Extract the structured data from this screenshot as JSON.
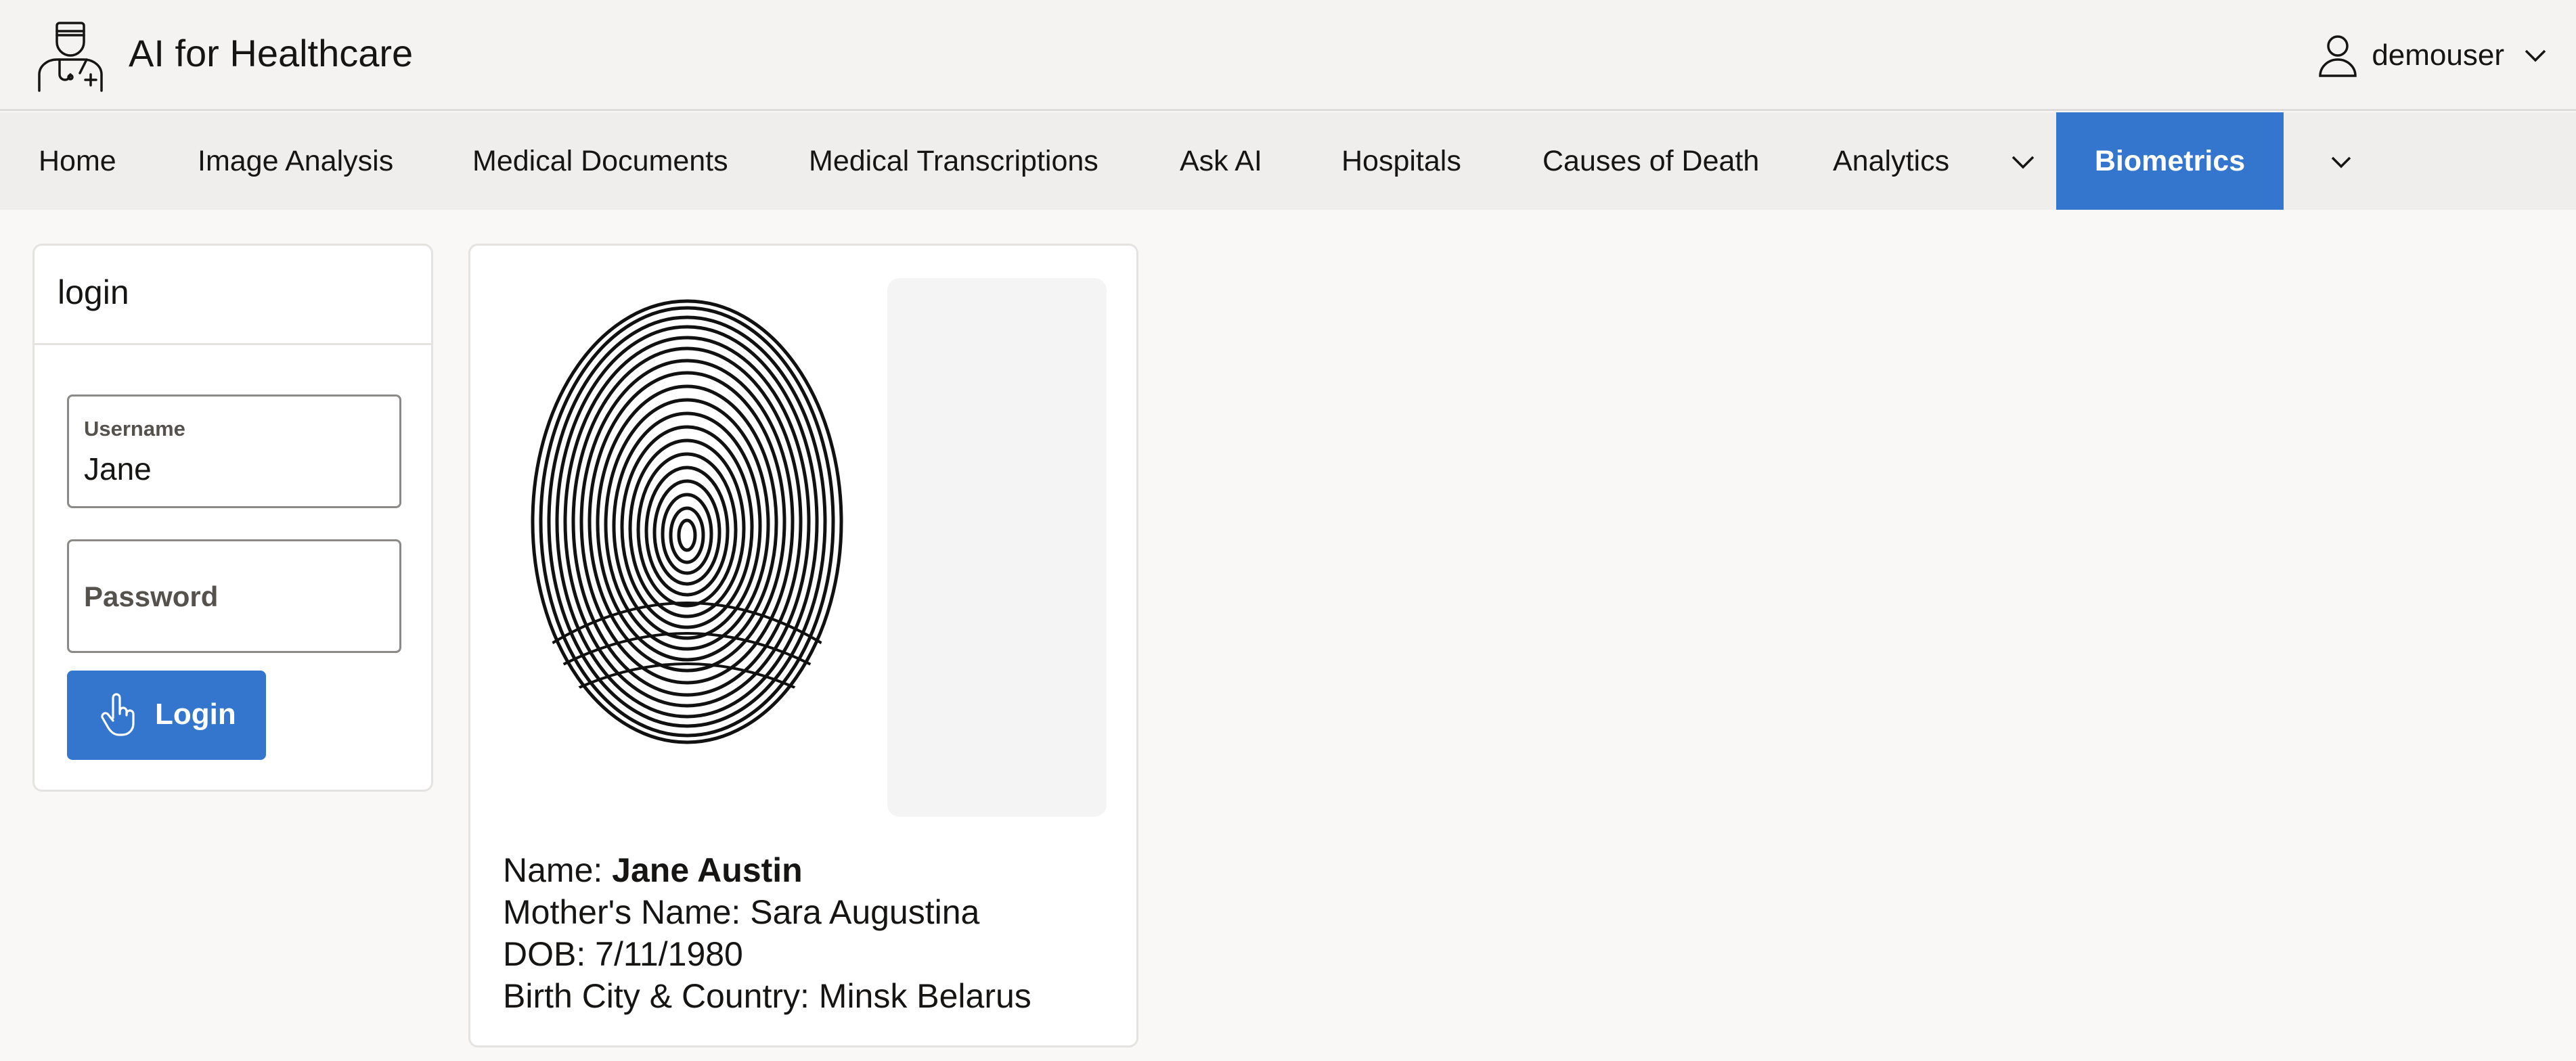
{
  "app": {
    "title": "AI for Healthcare"
  },
  "user": {
    "name": "demouser"
  },
  "nav": {
    "items": [
      {
        "label": "Home"
      },
      {
        "label": "Image Analysis"
      },
      {
        "label": "Medical Documents"
      },
      {
        "label": "Medical Transcriptions"
      },
      {
        "label": "Ask AI"
      },
      {
        "label": "Hospitals"
      },
      {
        "label": "Causes of Death"
      },
      {
        "label": "Analytics"
      }
    ],
    "active": "Biometrics"
  },
  "login": {
    "title": "login",
    "username_label": "Username",
    "username_value": "Jane",
    "password_placeholder": "Password",
    "button_label": "Login"
  },
  "record": {
    "name_label": "Name: ",
    "name_value": "Jane Austin",
    "mother_label": "Mother's Name: ",
    "mother_value": "Sara Augustina",
    "dob_label": "DOB: ",
    "dob_value": "7/11/1980",
    "birth_label": "Birth City & Country: ",
    "birth_value": "Minsk Belarus"
  },
  "colors": {
    "accent": "#3476ce",
    "header_bg": "#f4f3f1",
    "nav_bg": "#efeeec",
    "page_bg": "#f9f8f6"
  },
  "icons": {
    "logo": "doctor-stethoscope-icon",
    "user": "user-icon",
    "login_button": "hand-pointer-icon"
  }
}
